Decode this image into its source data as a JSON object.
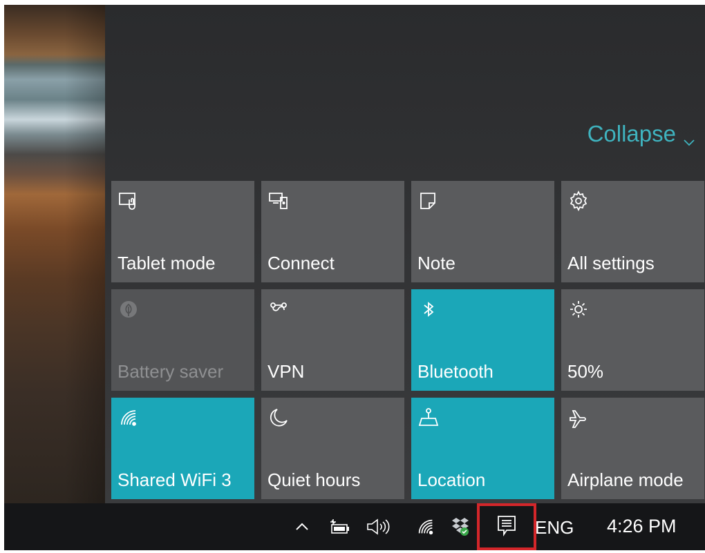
{
  "action_center": {
    "collapse_label": "Collapse",
    "accent_color": "#1ba7b8",
    "tiles": [
      {
        "label": "Tablet mode",
        "icon": "tablet-mode-icon",
        "state": "off"
      },
      {
        "label": "Connect",
        "icon": "connect-icon",
        "state": "off"
      },
      {
        "label": "Note",
        "icon": "note-icon",
        "state": "off"
      },
      {
        "label": "All settings",
        "icon": "settings-gear-icon",
        "state": "off"
      },
      {
        "label": "Battery saver",
        "icon": "battery-saver-icon",
        "state": "disabled"
      },
      {
        "label": "VPN",
        "icon": "vpn-icon",
        "state": "off"
      },
      {
        "label": "Bluetooth",
        "icon": "bluetooth-icon",
        "state": "on"
      },
      {
        "label": "50%",
        "icon": "brightness-icon",
        "state": "off"
      },
      {
        "label": "Shared WiFi 3",
        "icon": "wifi-icon",
        "state": "on"
      },
      {
        "label": "Quiet hours",
        "icon": "moon-icon",
        "state": "off"
      },
      {
        "label": "Location",
        "icon": "location-icon",
        "state": "on"
      },
      {
        "label": "Airplane mode",
        "icon": "airplane-icon",
        "state": "off"
      }
    ]
  },
  "taskbar": {
    "language": "ENG",
    "time": "4:26 PM",
    "highlight_color": "#d3262a",
    "tray_icons": [
      "show-hidden-icons-chevron",
      "battery-icon",
      "volume-icon",
      "wifi-icon",
      "dropbox-icon",
      "action-center-icon"
    ]
  }
}
